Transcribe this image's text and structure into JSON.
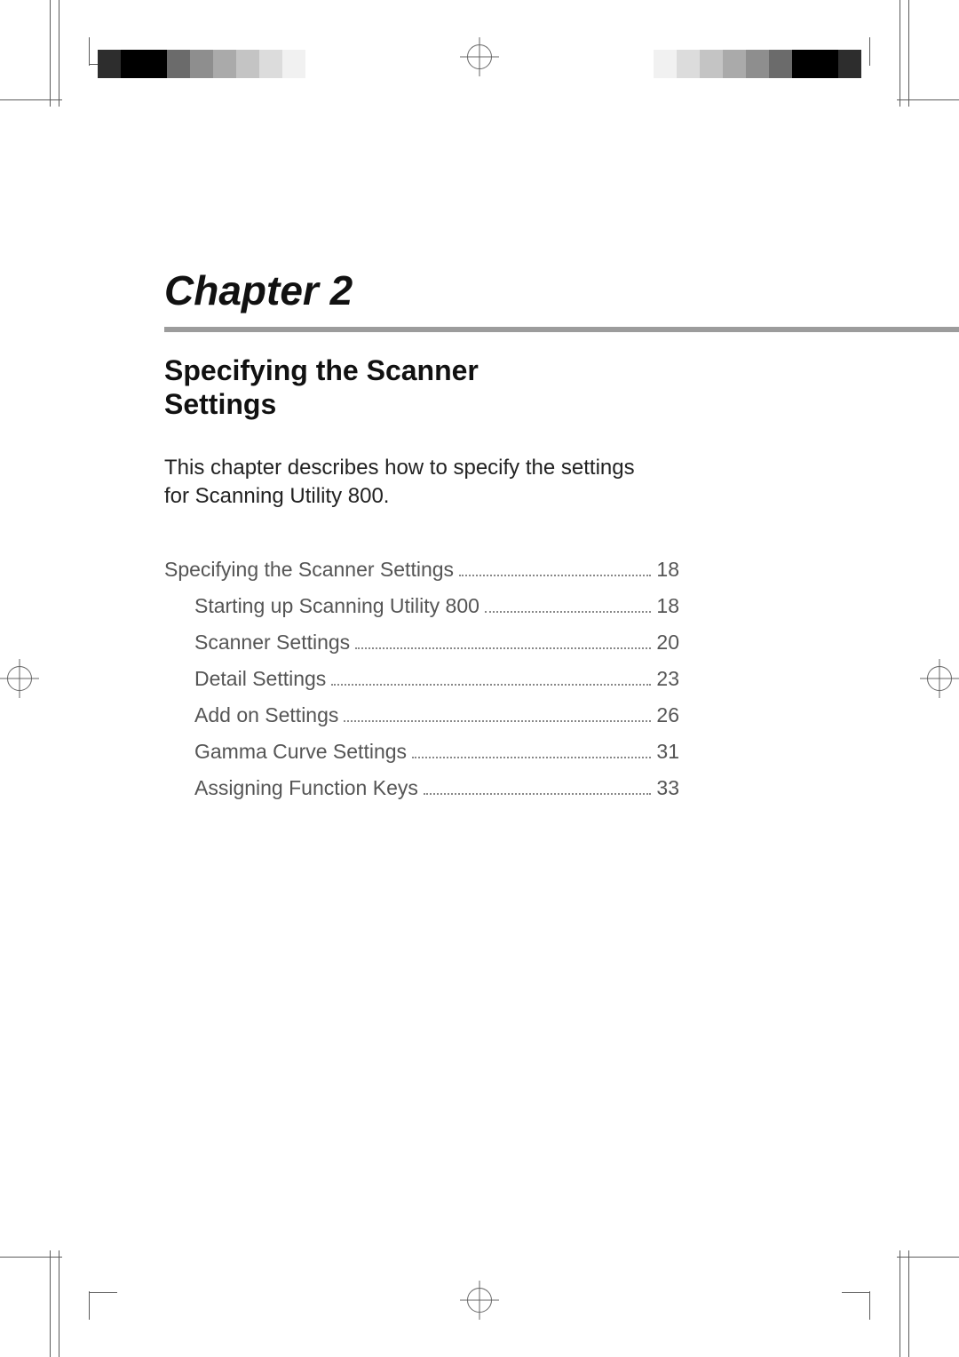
{
  "chapter": {
    "label": "Chapter 2",
    "title": "Specifying the Scanner Settings",
    "intro": "This chapter describes how to specify the settings for Scanning Utility 800."
  },
  "toc": [
    {
      "label": "Specifying the Scanner Settings",
      "page": "18",
      "level": 0
    },
    {
      "label": "Starting up Scanning Utility 800",
      "page": "18",
      "level": 1
    },
    {
      "label": "Scanner Settings",
      "page": "20",
      "level": 1
    },
    {
      "label": "Detail Settings",
      "page": "23",
      "level": 1
    },
    {
      "label": "Add on Settings",
      "page": "26",
      "level": 1
    },
    {
      "label": "Gamma Curve Settings",
      "page": "31",
      "level": 1
    },
    {
      "label": "Assigning Function Keys",
      "page": "33",
      "level": 1
    }
  ]
}
